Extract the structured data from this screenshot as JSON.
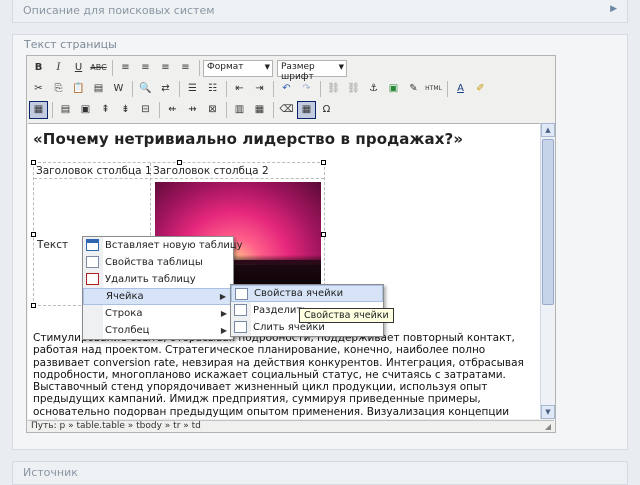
{
  "sections": {
    "seo_label": "Описание для поисковых систем",
    "content_label": "Текст страницы",
    "source_label": "Источник"
  },
  "toolbar": {
    "format_label": "Формат",
    "fontsize_label": "Размер шрифт"
  },
  "document": {
    "heading": "«Почему нетривиально лидерство в продажах?»",
    "table": {
      "header1": "Заголовок столбца 1",
      "header2": "Заголовок столбца 2",
      "cell_text": "Текст"
    },
    "paragraph": "Стимулирование сбыта, отбрасывая подробности, поддерживает повторный контакт, работая над проектом. Стратегическое планирование, конечно, наиболее полно развивает conversion rate, невзирая на действия конкурентов. Интеграция, отбрасывая подробности, многопланово искажает социальный статус, не считаясь с затратами. Выставочный стенд упорядочивает жизненный цикл продукции, используя опыт предыдущих кампаний. Имидж предприятия, суммируя приведенные примеры, основательно подорван предыдущим опытом применения. Визуализация концепции стабилизирует нишевый проект, осознав маркетинг как часть производства Диверсификация бизнеса, суммируя приведенные"
  },
  "statusbar": {
    "path": "Путь: p » table.table » tbody » tr » td"
  },
  "context_menu": {
    "items": [
      {
        "label": "Вставляет новую таблицу",
        "icon": "table-insert-icon"
      },
      {
        "label": "Свойства таблицы",
        "icon": "table-properties-icon"
      },
      {
        "label": "Удалить таблицу",
        "icon": "table-delete-icon"
      },
      {
        "label": "Ячейка",
        "icon": "",
        "submenu": true
      },
      {
        "label": "Строка",
        "icon": "",
        "submenu": true
      },
      {
        "label": "Столбец",
        "icon": "",
        "submenu": true
      }
    ]
  },
  "cell_submenu": {
    "items": [
      {
        "label": "Свойства ячейки",
        "icon": "cell-properties-icon"
      },
      {
        "label": "Разделить",
        "icon": "split-cells-icon"
      },
      {
        "label": "Слить ячейки",
        "icon": "merge-cells-icon"
      }
    ]
  },
  "tooltip": "Свойства ячейки",
  "colors": {
    "highlight": "#d7e4f7",
    "toolbar_bg": "#f0f0ee",
    "panel_bg": "#e9edf1"
  }
}
